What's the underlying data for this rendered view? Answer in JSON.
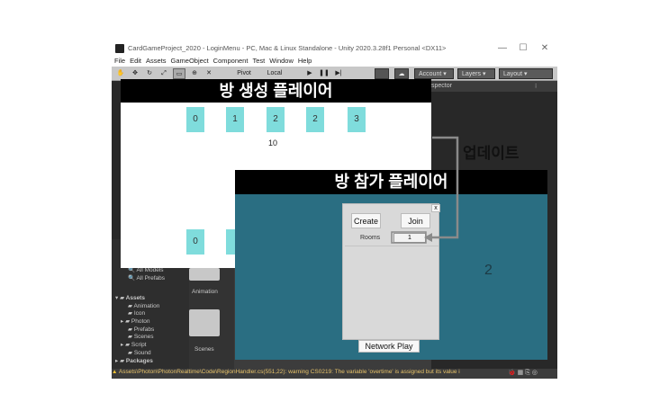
{
  "window": {
    "title": "CardGameProject_2020 - LoginMenu - PC, Mac & Linux Standalone - Unity 2020.3.28f1 Personal <DX11>",
    "minimize": "—",
    "maximize": "☐",
    "close": "✕"
  },
  "menu": [
    "File",
    "Edit",
    "Assets",
    "GameObject",
    "Component",
    "Test",
    "Window",
    "Help"
  ],
  "toolbar": {
    "pivot": "Pivot",
    "local": "Local",
    "account": "Account",
    "layers": "Layers",
    "layout": "Layout"
  },
  "panels": {
    "inspector_tab": "spector"
  },
  "project": {
    "search_items": [
      "All Models",
      "All Prefabs"
    ],
    "assets_label": "Assets",
    "asset_folders": [
      "Animation",
      "Icon",
      "Photon",
      "Prefabs",
      "Scenes",
      "Script",
      "Sound"
    ],
    "packages_label": "Packages",
    "grid_folders": [
      "Animation",
      "Scenes"
    ]
  },
  "status": {
    "warning": "Assets\\Photon\\PhotonRealtime\\Code\\RegionHandler.cs(551,22): warning CS0219: The variable 'overtime' is assigned but its value i"
  },
  "creator": {
    "title": "방 생성 플레이어",
    "buttons": [
      "0",
      "1",
      "2",
      "2",
      "3"
    ],
    "count": "10",
    "bottom_button": "0"
  },
  "joiner": {
    "title": "방 참가 플레이어",
    "close": "x",
    "create": "Create",
    "join": "Join",
    "rooms_label": "Rooms",
    "rooms_value": "1",
    "network_play": "Network Play",
    "count": "2"
  },
  "annotation": {
    "update_label": "업데이트"
  },
  "colors": {
    "unity_dark": "#383838",
    "cyan_button": "#7fdcdc",
    "join_bg": "#2a6e82",
    "arrow": "#8a8a8a"
  }
}
